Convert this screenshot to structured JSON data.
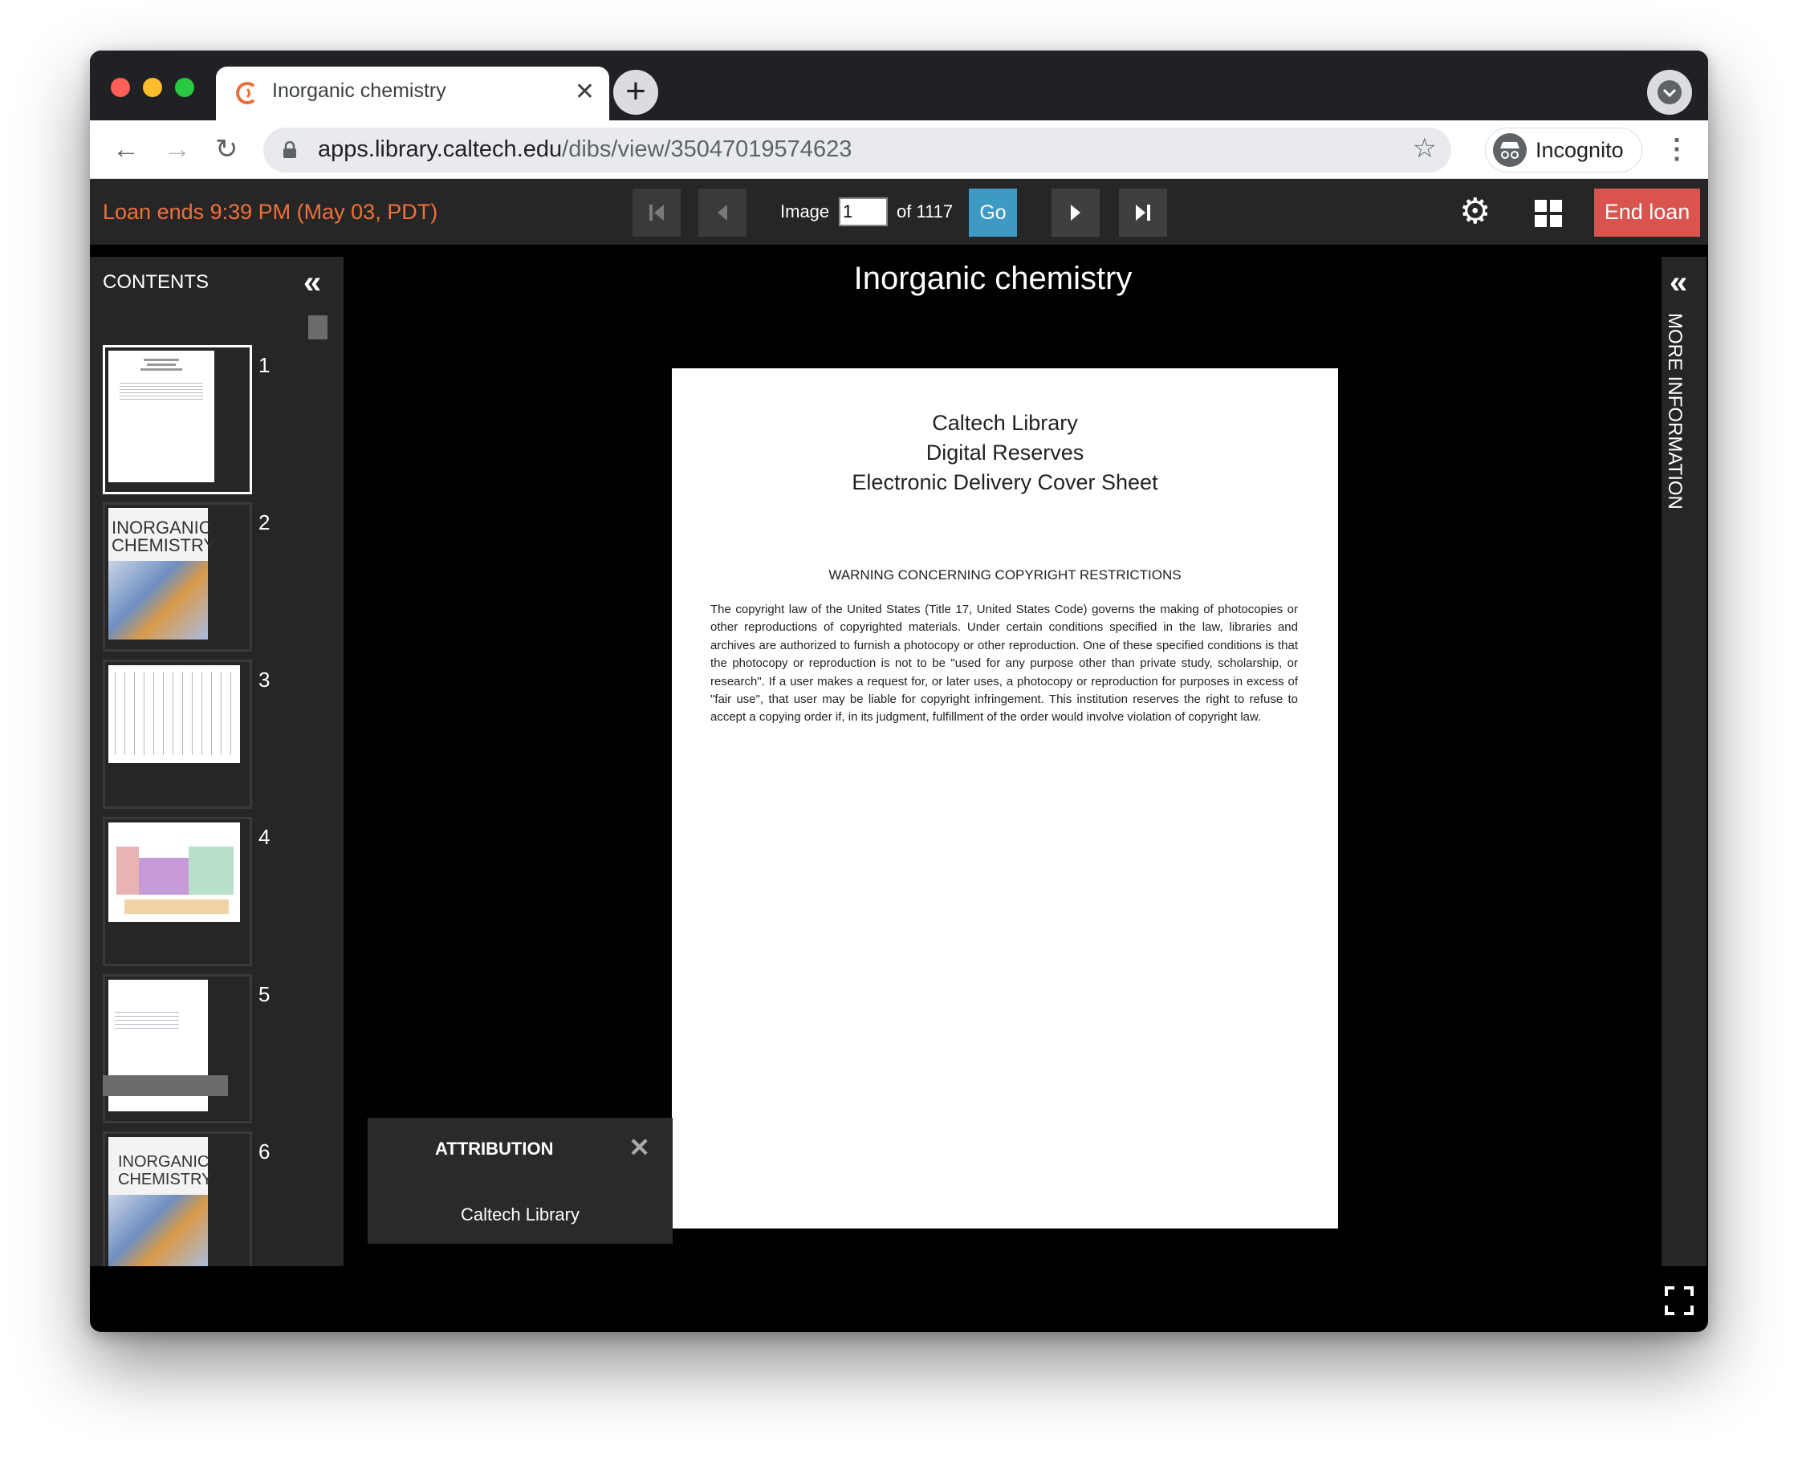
{
  "browser": {
    "tab_title": "Inorganic chemistry",
    "url_host": "apps.library.caltech.edu",
    "url_path": "/dibs/view/35047019574623",
    "profile_label": "Incognito"
  },
  "viewer": {
    "loan_text": "Loan ends 9:39 PM (May 03, PDT)",
    "image_label": "Image",
    "image_value": "1",
    "of_label": "of 1117",
    "go_label": "Go",
    "end_loan_label": "End loan",
    "title": "Inorganic chemistry"
  },
  "sidebar": {
    "title": "CONTENTS",
    "pages": [
      "1",
      "2",
      "3",
      "4",
      "5",
      "6"
    ]
  },
  "thumbnails": {
    "cover_line1": "INORGANIC",
    "cover_line2": "CHEMISTRY"
  },
  "document": {
    "heading1": "Caltech Library",
    "heading2": "Digital Reserves",
    "heading3": "Electronic Delivery Cover Sheet",
    "warning": "WARNING CONCERNING COPYRIGHT RESTRICTIONS",
    "body": "The copyright law of the United States (Title 17, United States Code) governs the making of photocopies or other reproductions of copyrighted materials. Under certain conditions specified in the law, libraries and archives are authorized to furnish a photocopy or other reproduction. One of these specified conditions is that the photocopy or reproduction is not to be \"used for any purpose other than private study, scholarship, or research\". If a user makes a request for, or later uses, a photocopy or reproduction for purposes in excess of \"fair use\", that user may be liable for copyright infringement. This institution reserves the right to refuse to accept a copying order if, in its judgment, fulfillment of the order would involve violation of copyright law."
  },
  "attribution": {
    "title": "ATTRIBUTION",
    "value": "Caltech Library"
  },
  "right_panel": {
    "label": "MORE INFORMATION"
  },
  "colors": {
    "loan_text": "#f0713a",
    "go_button": "#3d9ac4",
    "end_loan_button": "#d9534f",
    "favicon": "#e8703a"
  },
  "icons": [
    "back-arrow-icon",
    "forward-arrow-icon",
    "reload-icon",
    "lock-icon",
    "star-icon",
    "incognito-icon",
    "kebab-menu-icon",
    "first-page-icon",
    "prev-page-icon",
    "next-page-icon",
    "last-page-icon",
    "gear-icon",
    "grid-icon",
    "collapse-left-icon",
    "collapse-right-icon",
    "close-icon",
    "fullscreen-icon"
  ]
}
